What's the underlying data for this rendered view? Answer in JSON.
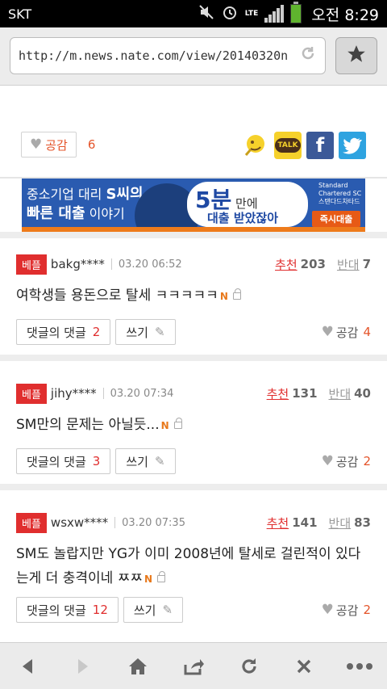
{
  "status": {
    "carrier": "SKT",
    "lte": "LTE",
    "time": "오전 8:29"
  },
  "browser": {
    "url": "http://m.news.nate.com/view/20140320n"
  },
  "article": {
    "like_label": "공감",
    "like_count": "6"
  },
  "share": {
    "kakaostory": "",
    "kakaotalk": "TALK",
    "facebook": "f",
    "twitter": ""
  },
  "banner": {
    "line1_a": "중소기업 대리 ",
    "line1_b": "S씨의",
    "line2_a": "빠른 대출",
    "line2_b": " 이야기",
    "big": "5분",
    "big_suffix": " 만에",
    "line3": "대출 받았잖아",
    "sponsor": "Standard Chartered SC 스탠다드차타드",
    "cta": "즉시대출"
  },
  "comments": [
    {
      "badge": "베플",
      "user": "bakg****",
      "date": "03.20 06:52",
      "rec_label": "추천",
      "rec": "203",
      "opp_label": "반대",
      "opp": "7",
      "text": "여학생들 용돈으로 탈세 ㅋㅋㅋㅋㅋ",
      "reply_label": "댓글의 댓글",
      "reply_count": "2",
      "write_label": "쓰기",
      "like_label": "공감",
      "like": "4"
    },
    {
      "badge": "베플",
      "user": "jihy****",
      "date": "03.20 07:34",
      "rec_label": "추천",
      "rec": "131",
      "opp_label": "반대",
      "opp": "40",
      "text": "SM만의 문제는 아닐듯...",
      "reply_label": "댓글의 댓글",
      "reply_count": "3",
      "write_label": "쓰기",
      "like_label": "공감",
      "like": "2"
    },
    {
      "badge": "베플",
      "user": "wsxw****",
      "date": "03.20 07:35",
      "rec_label": "추천",
      "rec": "141",
      "opp_label": "반대",
      "opp": "83",
      "text": "SM도 놀랍지만 YG가 이미 2008년에 탈세로 걸린적이 있다는게 더 충격이네 ㅉㅉ",
      "reply_label": "댓글의 댓글",
      "reply_count": "12",
      "write_label": "쓰기",
      "like_label": "공감",
      "like": "2"
    }
  ],
  "new_mark": "N",
  "colors": {
    "accent": "#e02e2e",
    "like": "#e4542a",
    "banner": "#2a5bb0"
  }
}
